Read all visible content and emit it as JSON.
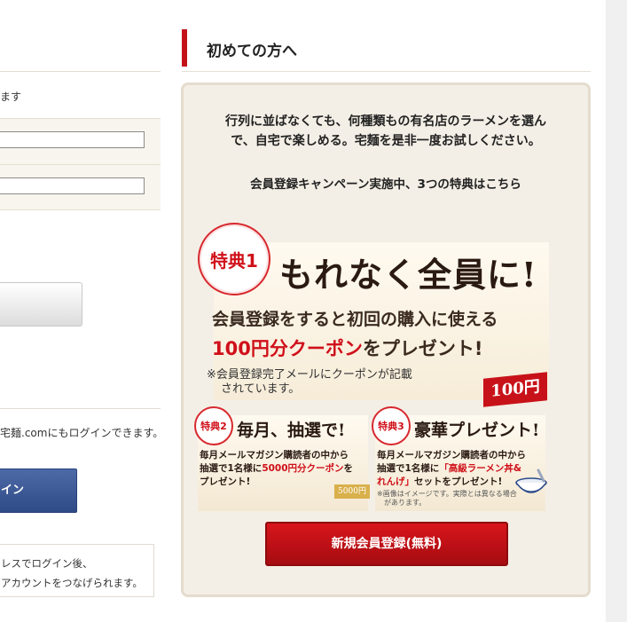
{
  "left": {
    "text_masu": "ます",
    "text_com_login": "宅麺.comにもログインできます。",
    "blue_button_label": "イン",
    "note_line1": "レスでログイン後、",
    "note_line2": "アカウントをつなげられます。"
  },
  "section": {
    "title": "初めての方へ",
    "intro_line1": "行列に並ばなくても、何種類もの有名店のラーメンを選ん",
    "intro_line2": "で、自宅で楽しめる。宅麺を是非一度お試しください。",
    "campaign": "会員登録キャンペーン実施中、3つの特典はこちら"
  },
  "benefit1": {
    "badge": "特典1",
    "headline": "もれなく全員に!",
    "line2": "会員登録をすると初回の購入に使える",
    "line3_red": "100円分クーポン",
    "line3_rest": "をプレゼント!",
    "note1": "※会員登録完了メールにクーポンが記載",
    "note2": "されています。",
    "tag": "100円"
  },
  "benefit2": {
    "badge": "特典2",
    "headline": "毎月、抽選で!",
    "desc1": "毎月メールマガジン購読者の中から",
    "desc2_pre": "抽選で1名様に",
    "desc2_red": "5000円分クーポン",
    "desc2_post": "を",
    "desc3": "プレゼント!",
    "tag": "5000円"
  },
  "benefit3": {
    "badge": "特典3",
    "headline": "豪華プレゼント!",
    "desc1": "毎月メールマガジン購読者の中から",
    "desc2_pre": "抽選で1名様に",
    "desc2_red": "「高級ラーメン丼&",
    "desc3_red": "れんげ」",
    "desc3_post": "セットをプレゼント!",
    "tiny1": "※画像はイメージです。実際とは異なる場合",
    "tiny2": "があります。"
  },
  "register_button": "新規会員登録(無料)",
  "colors": {
    "accent_red": "#c4121a",
    "panel_bg": "#f4efe6",
    "blue_button": "#3b5795"
  }
}
